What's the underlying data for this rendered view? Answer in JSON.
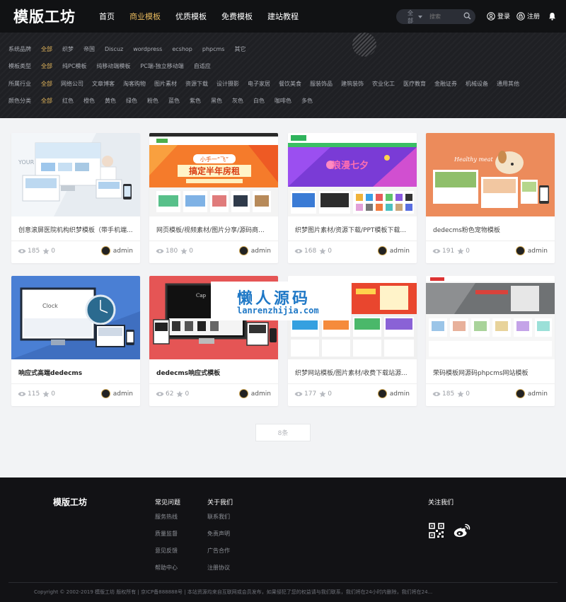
{
  "header": {
    "logo": "模版工坊",
    "nav": [
      "首页",
      "商业模板",
      "优质模板",
      "免费模板",
      "建站教程"
    ],
    "search": {
      "scope": "全部",
      "placeholder": "搜索"
    },
    "login": "登录",
    "register": "注册"
  },
  "filters": [
    {
      "label": "系统品牌",
      "options": [
        "全部",
        "织梦",
        "帝国",
        "Discuz",
        "wordpress",
        "ecshop",
        "phpcms",
        "其它"
      ]
    },
    {
      "label": "模板类型",
      "options": [
        "全部",
        "纯PC模板",
        "纯移动端模板",
        "PC端-独立移动端",
        "自适应"
      ]
    },
    {
      "label": "所属行业",
      "options": [
        "全部",
        "网络公司",
        "文章博客",
        "淘客购物",
        "图片素材",
        "资源下载",
        "设计摄影",
        "电子家居",
        "餐饮美食",
        "服装饰品",
        "建筑装饰",
        "农业化工",
        "医疗教育",
        "金融证券",
        "机械设备",
        "通用其他"
      ]
    },
    {
      "label": "颜色分类",
      "options": [
        "全部",
        "红色",
        "橙色",
        "黄色",
        "绿色",
        "粉色",
        "蓝色",
        "紫色",
        "黑色",
        "灰色",
        "白色",
        "咖啡色",
        "多色"
      ]
    }
  ],
  "cards": [
    {
      "title": "创意滚屏医院机构织梦模板（带手机端...",
      "views": "185",
      "likes": "0",
      "author": "admin",
      "bold": false
    },
    {
      "title": "网页模板/视频素材/图片分享/源码商...",
      "views": "180",
      "likes": "0",
      "author": "admin",
      "bold": false
    },
    {
      "title": "织梦图片素材/资源下载/PPT模板下载...",
      "views": "168",
      "likes": "0",
      "author": "admin",
      "bold": false
    },
    {
      "title": "dedecms粉色宠物模板",
      "views": "191",
      "likes": "0",
      "author": "admin",
      "bold": false
    },
    {
      "title": "响应式高端dedecms",
      "views": "115",
      "likes": "0",
      "author": "admin",
      "bold": true
    },
    {
      "title": "dedecms响应式模板",
      "views": "62",
      "likes": "0",
      "author": "admin",
      "bold": true
    },
    {
      "title": "织梦网站模板/图片素材/收费下载站源...",
      "views": "177",
      "likes": "0",
      "author": "admin",
      "bold": false
    },
    {
      "title": "荣码模板网源码phpcms网站模板",
      "views": "185",
      "likes": "0",
      "author": "admin",
      "bold": false
    }
  ],
  "thumbs": {
    "t2_banner": "小手一“飞”",
    "t2_headline": "搞定半年房租",
    "t3_banner": "浪漫七夕",
    "t4_tagline": "Healthy meat",
    "t5_clock": "Clock"
  },
  "more_button": "8条",
  "watermark": {
    "cn": "懒人源码",
    "en": "lanrenzhijia.com"
  },
  "footer": {
    "logo": "模版工坊",
    "col1": {
      "title": "常见问题",
      "links": [
        "服务热线",
        "质量监督",
        "意见反馈",
        "帮助中心"
      ]
    },
    "col2": {
      "title": "关于我们",
      "links": [
        "联系我们",
        "免责声明",
        "广告合作",
        "注册协议"
      ]
    },
    "follow": "关注我们",
    "copyright": "Copyright © 2002-2019 模版工坊 版权所有 | 京ICP备888888号 | 本站资源均来自互联网或会员发布，如果侵犯了您的权益请与我们联系，我们将在24小时内删除，我们将在24..."
  },
  "colors": {
    "accent": "#e6b85c",
    "header_bg": "#111214",
    "footer_bg": "#121215",
    "watermark_blue": "#1f78c6"
  }
}
